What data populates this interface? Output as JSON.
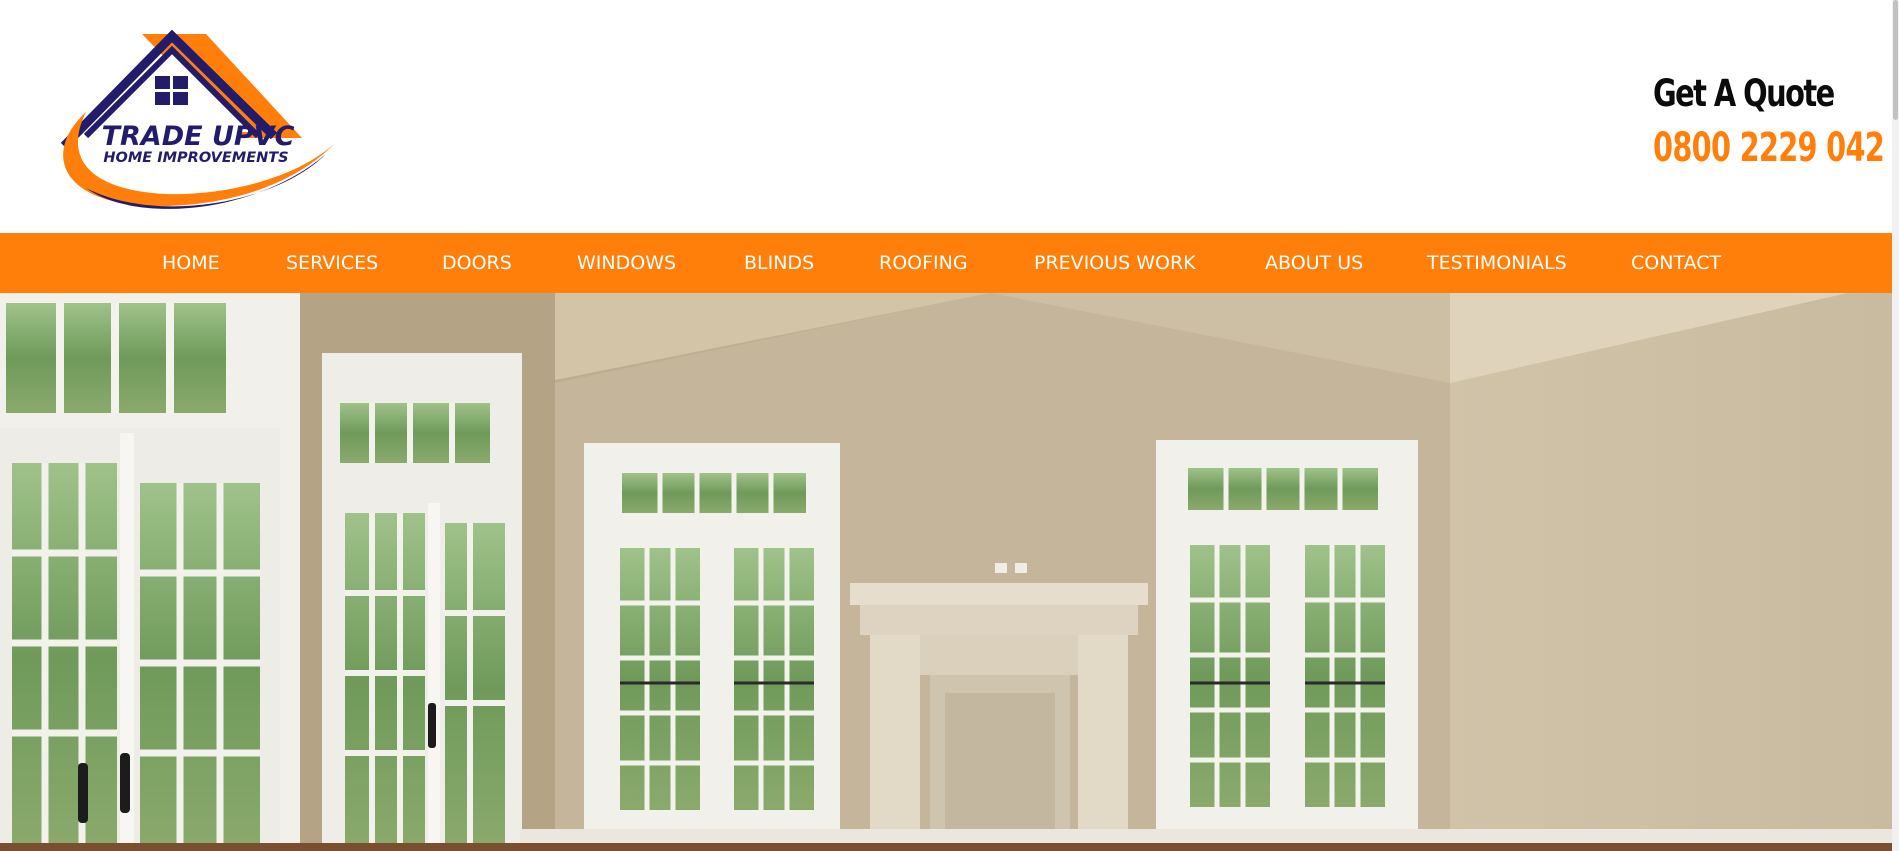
{
  "logo": {
    "line1": "TRADE UPVC",
    "line2": "HOME IMPROVEMENTS",
    "brand_orange": "#ff7f0a",
    "brand_navy": "#231c6b"
  },
  "quote": {
    "title": "Get A Quote",
    "phone": "0800 2229 042"
  },
  "nav": {
    "bg_color": "#ff7f0a",
    "items": [
      {
        "label": "HOME"
      },
      {
        "label": "SERVICES"
      },
      {
        "label": "DOORS"
      },
      {
        "label": "WINDOWS"
      },
      {
        "label": "BLINDS"
      },
      {
        "label": "ROOFING"
      },
      {
        "label": "PREVIOUS WORK"
      },
      {
        "label": "ABOUT US"
      },
      {
        "label": "TESTIMONIALS"
      },
      {
        "label": "CONTACT"
      }
    ]
  },
  "hero": {
    "image": "interior-room-with-french-doors-and-fireplace"
  }
}
